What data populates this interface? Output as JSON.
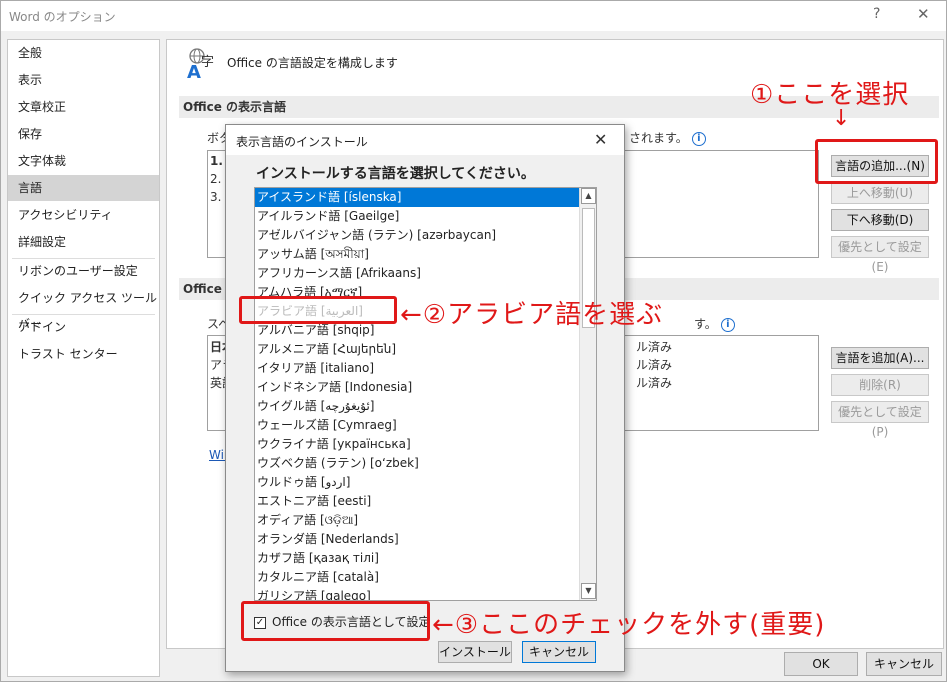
{
  "window": {
    "title": "Word のオプション",
    "help": "?",
    "close": "✕"
  },
  "nav": {
    "items": [
      {
        "label": "全般"
      },
      {
        "label": "表示"
      },
      {
        "label": "文章校正"
      },
      {
        "label": "保存"
      },
      {
        "label": "文字体裁"
      },
      {
        "label": "言語"
      },
      {
        "label": "アクセシビリティ"
      },
      {
        "label": "詳細設定"
      },
      {
        "label": "リボンのユーザー設定"
      },
      {
        "label": "クイック アクセス ツール バー"
      },
      {
        "label": "アドイン"
      },
      {
        "label": "トラスト センター"
      }
    ],
    "selected_index": 5
  },
  "main": {
    "header_title": "Office の言語設定を構成します",
    "display_lang_section": "Office の表示言語",
    "display_lang_desc_start": "ボタ",
    "display_lang_desc_end": "されます。",
    "display_rows": [
      "1.",
      "2.",
      "3."
    ],
    "authoring_section": "Office",
    "proofing_desc_start": "スペ",
    "proofing_desc_end": "す。",
    "proofing_rows_left": [
      "日本",
      "アラ",
      "英語"
    ],
    "proofing_rows_right": [
      "ル済み",
      "ル済み",
      "ル済み"
    ],
    "win_link": "Win",
    "buttons": {
      "add_display": "言語の追加...(N)",
      "move_up": "上へ移動(U)",
      "move_down": "下へ移動(D)",
      "set_preferred_1": "優先として設定(E)",
      "add_proofing": "言語を追加(A)...",
      "remove": "削除(R)",
      "set_preferred_2": "優先として設定(P)"
    }
  },
  "footer": {
    "ok": "OK",
    "cancel": "キャンセル"
  },
  "dialog": {
    "title": "表示言語のインストール",
    "close": "✕",
    "heading": "インストールする言語を選択してください。",
    "languages": [
      "アイスランド語 [íslenska]",
      "アイルランド語 [Gaeilge]",
      "アゼルバイジャン語 (ラテン) [azərbaycan]",
      "アッサム語 [অসমীয়া]",
      "アフリカーンス語 [Afrikaans]",
      "アムハラ語 [አማርኛ]",
      "アラビア語 [العربية]",
      "アルバニア語 [shqip]",
      "アルメニア語 [Հայերեն]",
      "イタリア語 [italiano]",
      "インドネシア語 [Indonesia]",
      "ウイグル語 [ئۇيغۇرچە]",
      "ウェールズ語 [Cymraeg]",
      "ウクライナ語 [українська]",
      "ウズベク語 (ラテン) [o‘zbek]",
      "ウルドゥ語 [اردو]",
      "エストニア語 [eesti]",
      "オディア語 [ଓଡ଼ିଆ]",
      "オランダ語 [Nederlands]",
      "カザフ語 [қазақ тілі]",
      "カタルニア語 [català]",
      "ガリシア語 [galego]"
    ],
    "selected_index": 0,
    "highlighted_index": 6,
    "checkbox_label": "Office の表示言語として設定",
    "checkbox_mark": "✓",
    "install": "インストール",
    "cancel": "キャンセル"
  },
  "annotations": {
    "step1": "①ここを選択",
    "step1_arrow": "↓",
    "step2": "←②アラビア語を選ぶ",
    "step3": "←③ここのチェックを外す(重要)"
  },
  "colors": {
    "annotation_red": "#e01818",
    "selection_blue": "#0078d7"
  }
}
